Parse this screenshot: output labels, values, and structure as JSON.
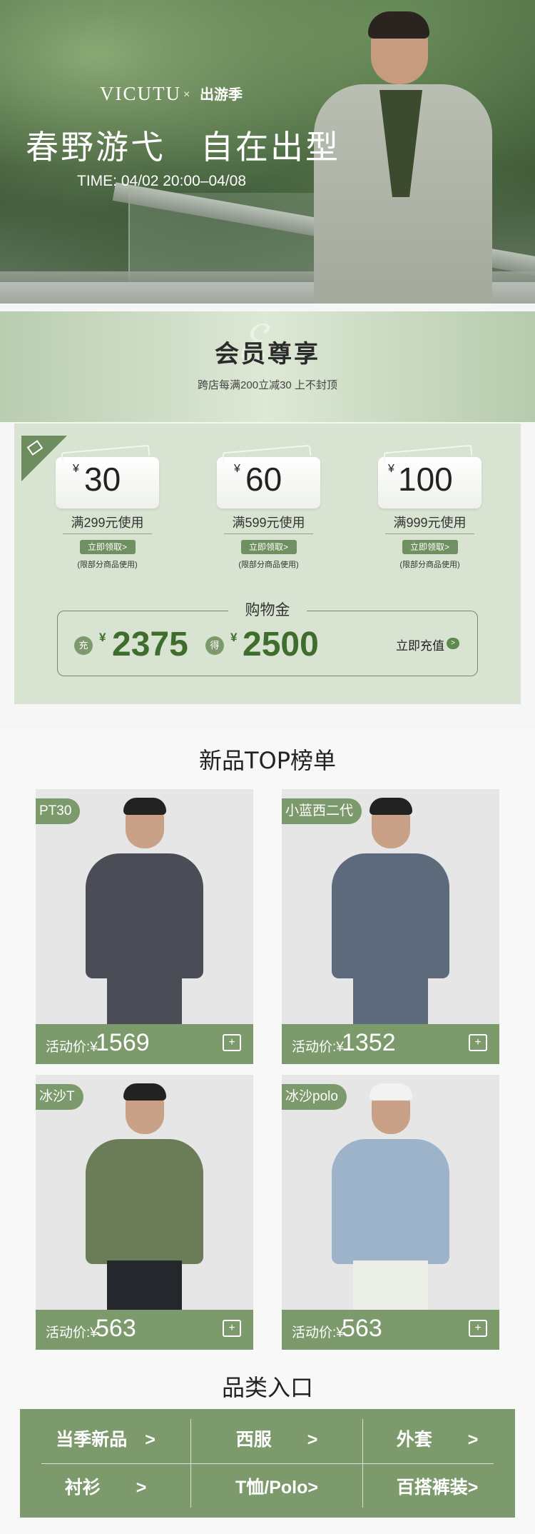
{
  "hero": {
    "brand": "VICUTU",
    "cross": "×",
    "partner": "出游季",
    "title": "春野游弋　自在出型",
    "time": "TIME: 04/02 20:00–04/08"
  },
  "member": {
    "title": "会员尊享",
    "subtitle": "跨店每满200立减30 上不封顶",
    "coupons": [
      {
        "currency": "¥",
        "amount": "30",
        "condition": "满299元使用",
        "button": "立即领取>",
        "note": "(限部分商品使用)"
      },
      {
        "currency": "¥",
        "amount": "60",
        "condition": "满599元使用",
        "button": "立即领取>",
        "note": "(限部分商品使用)"
      },
      {
        "currency": "¥",
        "amount": "100",
        "condition": "满999元使用",
        "button": "立即领取>",
        "note": "(限部分商品使用)"
      }
    ],
    "gold": {
      "label": "购物金",
      "charge_badge": "充",
      "charge_currency": "¥",
      "charge_amount": "2375",
      "get_badge": "得",
      "get_currency": "¥",
      "get_amount": "2500",
      "recharge": "立即充值"
    }
  },
  "top": {
    "title": "新品TOP榜单",
    "price_label": "活动价:",
    "currency": "¥",
    "products": [
      {
        "tag": "PT30",
        "price": "1569",
        "color": "#4a4d55"
      },
      {
        "tag": "小蓝西二代",
        "price": "1352",
        "color": "#5d6a7c"
      },
      {
        "tag": "冰沙T",
        "price": "563",
        "color": "#6b7d58"
      },
      {
        "tag": "冰沙polo",
        "price": "563",
        "color": "#9cb3c9"
      }
    ]
  },
  "category": {
    "title": "品类入口",
    "items": [
      "当季新品　>",
      "西服　　>",
      "外套　　>",
      "衬衫　　>",
      "T恤/Polo>",
      "百搭裤装>"
    ]
  },
  "colors": {
    "accent": "#7c9a6b",
    "accent_dark": "#3f6d2d",
    "coupon_bg": "#d8e3d2"
  }
}
